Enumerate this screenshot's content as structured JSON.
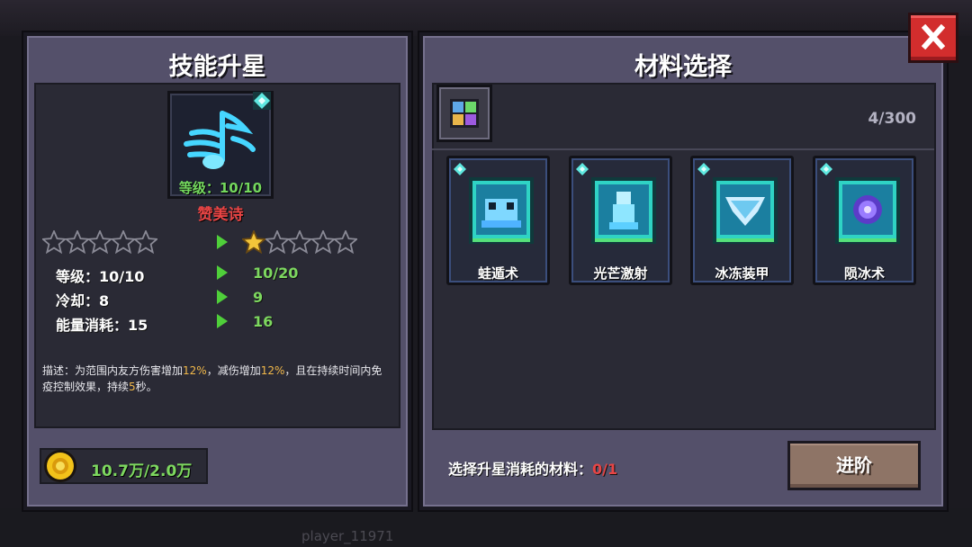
{
  "left_panel": {
    "title": "技能升星",
    "skill": {
      "icon": "music-note-skill-icon",
      "level_text": "等级：10/10",
      "name": "赞美诗"
    },
    "stars": {
      "current_filled": 0,
      "next_filled": 1,
      "total": 5
    },
    "stats": [
      {
        "label": "等级：10/10",
        "next": "10/20"
      },
      {
        "label": "冷却：8",
        "next": "9"
      },
      {
        "label": "能量消耗：15",
        "next": "16"
      }
    ],
    "description": {
      "p1": "描述：为范围内友方伤害增加",
      "h1": "12%",
      "p2": "，减伤增加",
      "h2": "12%",
      "p3": "，且在持续时间内免疫控制效果，持续",
      "h3": "5",
      "p4": "秒。"
    },
    "cost": "10.7万/2.0万"
  },
  "right_panel": {
    "title": "材料选择",
    "filter_icon": "grid-filter-icon",
    "count": "4/300",
    "materials": [
      {
        "name": "蛙遁术",
        "icon": "frog-book-icon"
      },
      {
        "name": "光芒激射",
        "icon": "light-burst-book-icon"
      },
      {
        "name": "冰冻装甲",
        "icon": "ice-armor-book-icon"
      },
      {
        "name": "陨冰术",
        "icon": "ice-meteor-book-icon"
      }
    ],
    "select_label": "选择升星消耗的材料：",
    "select_count": "0/1",
    "advance_button": "进阶"
  },
  "background": {
    "player_text": "player_11971"
  },
  "colors": {
    "panel": "#54506a",
    "inner": "#2a2a35",
    "green": "#7dd85f",
    "red": "#e84545",
    "orange": "#f1b84a",
    "close": "#d22d2d",
    "advance": "#8e7466"
  }
}
